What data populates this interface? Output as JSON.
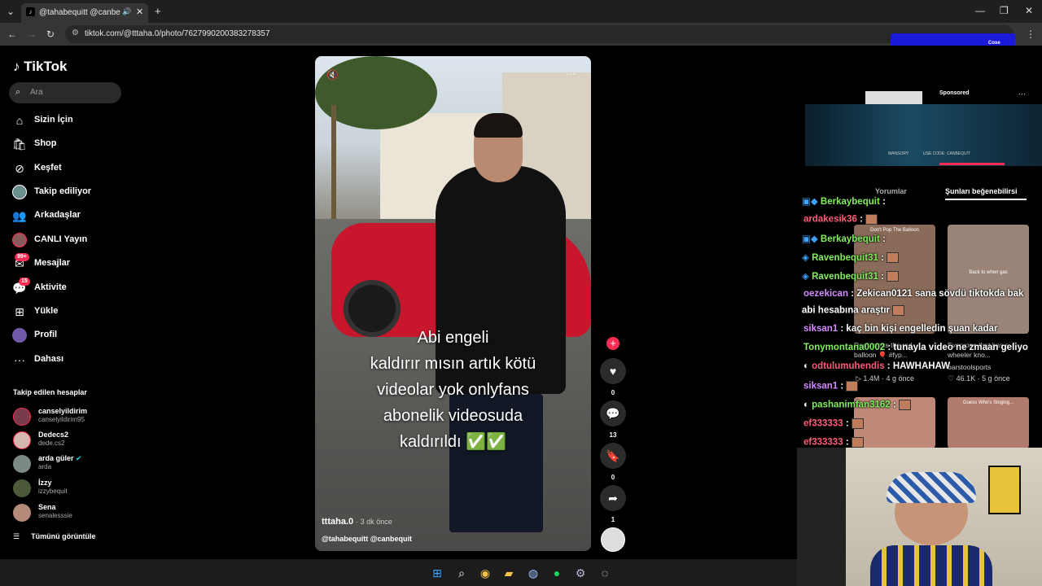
{
  "browser": {
    "tab_title": "@tahabequitt @canbequit",
    "tab_close": "✕",
    "new_tab": "+",
    "url": "tiktok.com/@tttaha.0/photo/7627990200383278357"
  },
  "sidebar": {
    "brand": "TikTok",
    "search_placeholder": "Ara",
    "nav": [
      {
        "label": "Sizin İçin",
        "icon": "home-icon"
      },
      {
        "label": "Shop",
        "icon": "shop-icon"
      },
      {
        "label": "Keşfet",
        "icon": "compass-icon"
      },
      {
        "label": "Takip ediliyor",
        "icon": "following-avatar-icon"
      },
      {
        "label": "Arkadaşlar",
        "icon": "friends-icon"
      },
      {
        "label": "CANLI Yayın",
        "icon": "live-icon"
      },
      {
        "label": "Mesajlar",
        "icon": "messages-icon",
        "badge": "99+"
      },
      {
        "label": "Aktivite",
        "icon": "activity-icon",
        "badge": "15"
      },
      {
        "label": "Yükle",
        "icon": "upload-icon"
      },
      {
        "label": "Profil",
        "icon": "profile-icon"
      },
      {
        "label": "Dahası",
        "icon": "more-icon"
      }
    ],
    "following_header": "Takip edilen hesaplar",
    "accounts": [
      {
        "name": "canselyildirim",
        "handle": "canselyildirim95"
      },
      {
        "name": "Dedecs2",
        "handle": "dede.cs2"
      },
      {
        "name": "arda güler",
        "handle": "arda"
      },
      {
        "name": "İzzy",
        "handle": "izzybequit"
      },
      {
        "name": "Sena",
        "handle": "senalesssie"
      }
    ],
    "see_all": "Tümünü görüntüle"
  },
  "video": {
    "caption": [
      "Abi engeli",
      "kaldırır mısın artık kötü",
      "videolar yok onlyfans",
      "abonelik videosuda",
      "kaldırıldı ✅✅"
    ],
    "author": "tttaha.0",
    "time": "· 3 dk önce",
    "tags": "@tahabequitt @canbequit"
  },
  "actions": {
    "likes": "0",
    "comments": "13",
    "saves": "0",
    "shares": "1"
  },
  "right_panel": {
    "sponsored": "Sponsored",
    "ad_brand": "MANSORY",
    "ad_code": "USE CODE: CANBEQUIT",
    "tab_comments": "Yorumlar",
    "tab_likes": "Şunları beğenebilirsi",
    "thumbs": [
      {
        "title": "Don't Pop The Balloon",
        "caption": "Don't press the red balloon 🎈 #fyp...",
        "views": "1.4M",
        "age": "4 g önce"
      },
      {
        "title": "Back to when gas"
      },
      {
        "title": "Back to when gas",
        "caption": "Everyone that has a 4 wheeler kno...",
        "user": "barstoolsports",
        "likes": "46.1K",
        "age": "5 g önce"
      },
      {
        "title": "Guess Who's Singing..."
      }
    ]
  },
  "chat": [
    {
      "user": "Berkaybequit",
      "text": ":",
      "color": "#7ff05c"
    },
    {
      "user": "ardakesik36",
      "text": ":",
      "color": "#ff5c7a"
    },
    {
      "user": "Berkaybequit",
      "text": ":",
      "color": "#7ff05c"
    },
    {
      "user": "Ravenbequit31",
      "text": ":",
      "color": "#7ff05c"
    },
    {
      "user": "Ravenbequit31",
      "text": ":",
      "color": "#7ff05c"
    },
    {
      "user": "oezekican",
      "text": ": Zekican0121 sana sövdü tiktokda bak",
      "color": "#d28cff"
    },
    {
      "user": "",
      "text": "abi hesabına araştır",
      "color": "#ffffff"
    },
    {
      "user": "siksan1",
      "text": ": kaç bin kişi engelledin şuan kadar",
      "color": "#d28cff"
    },
    {
      "user": "Tonymontana0002",
      "text": ": tunayla video ne zmaan geliyo",
      "color": "#7ff05c"
    },
    {
      "user": "odtulumuhendis",
      "text": ": HAWHAHAW",
      "color": "#ff5c7a"
    },
    {
      "user": "siksan1",
      "text": ":",
      "color": "#d28cff"
    },
    {
      "user": "pashanimfan3162",
      "text": ":",
      "color": "#7ff05c"
    },
    {
      "user": "ef333333",
      "text": ":",
      "color": "#ff5c7a"
    },
    {
      "user": "ef333333",
      "text": ":",
      "color": "#ff5c7a"
    }
  ],
  "overlay": {
    "topright_text": "Cose"
  },
  "colors": {
    "accent": "#fe2c55",
    "bg": "#000000",
    "chrome": "#1f1f1f"
  }
}
